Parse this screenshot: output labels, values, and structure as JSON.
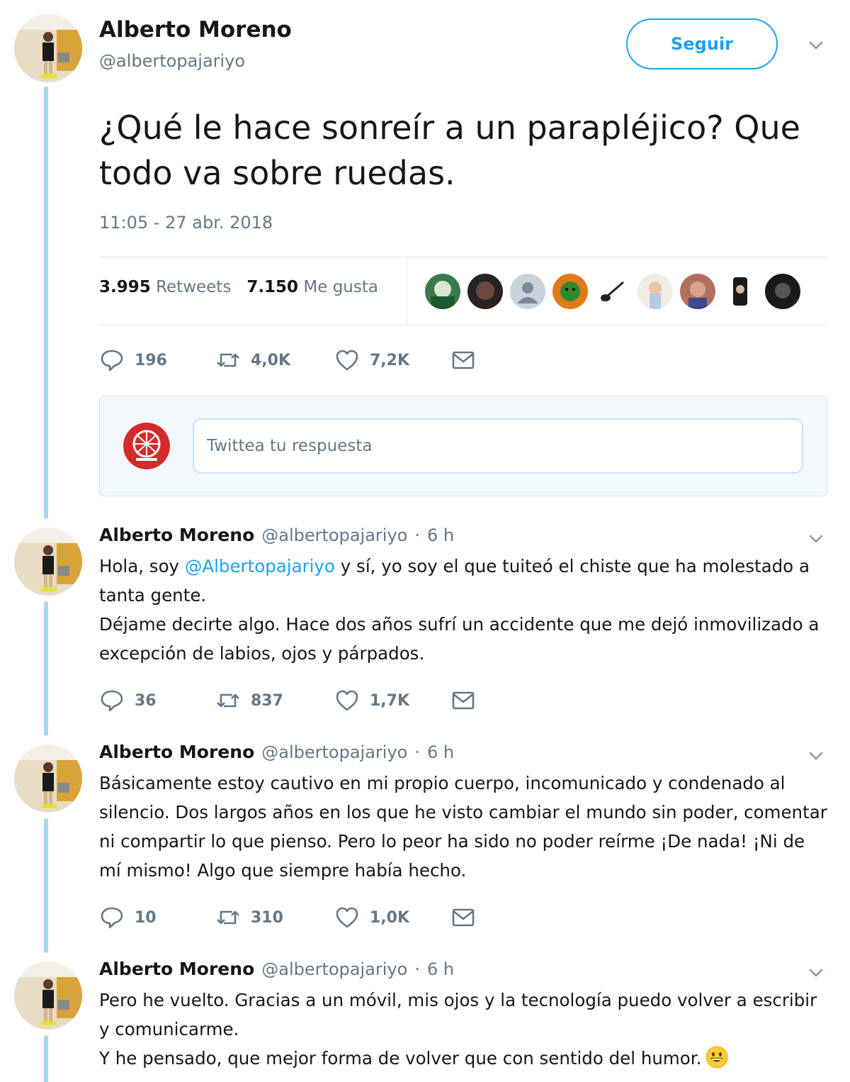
{
  "main_tweet": {
    "name": "Alberto Moreno",
    "handle": "@albertopajariyo",
    "follow_label": "Seguir",
    "text": "¿Qué le hace sonreír a un parapléjico? Que todo va sobre ruedas.",
    "timestamp": "11:05 - 27 abr. 2018",
    "retweets_count": "3.995",
    "retweets_label": "Retweets",
    "likes_count": "7.150",
    "likes_label": "Me gusta",
    "actions": {
      "replies": "196",
      "retweets": "4,0K",
      "likes": "7,2K"
    }
  },
  "reply_box": {
    "placeholder": "Twittea tu respuesta"
  },
  "thread": [
    {
      "name": "Alberto Moreno",
      "handle": "@albertopajariyo",
      "sep": "·",
      "time": "6 h",
      "text_before": "Hola, soy ",
      "mention": "@Albertopajariyo",
      "text_after": " y sí, yo soy el que tuiteó el chiste que ha molestado a tanta gente.\nDéjame decirte algo. Hace dos años sufrí un accidente que me dejó inmovilizado a excepción de labios, ojos y párpados.",
      "actions": {
        "replies": "36",
        "retweets": "837",
        "likes": "1,7K"
      }
    },
    {
      "name": "Alberto Moreno",
      "handle": "@albertopajariyo",
      "sep": "·",
      "time": "6 h",
      "text": "Básicamente estoy cautivo en mi propio cuerpo, incomunicado y condenado al silencio. Dos largos años en los que he visto cambiar el mundo sin poder, comentar ni compartir lo que pienso. Pero lo peor ha sido no poder reírme ¡De nada! ¡Ni de mí mismo! Algo que siempre había hecho.",
      "actions": {
        "replies": "10",
        "retweets": "310",
        "likes": "1,0K"
      }
    },
    {
      "name": "Alberto Moreno",
      "handle": "@albertopajariyo",
      "sep": "·",
      "time": "6 h",
      "text": "Pero he vuelto. Gracias a un móvil, mis ojos y la tecnología puedo volver a escribir y comunicarme.\nY he pensado, que mejor forma de volver que con sentido del humor.",
      "emoji": "grinning-face"
    }
  ],
  "icons": {
    "reply": "speech-bubble-icon",
    "retweet": "retweet-icon",
    "like": "heart-icon",
    "dm": "envelope-icon",
    "menu": "chevron-down-icon"
  },
  "colors": {
    "accent": "#1da1f2",
    "muted": "#657786",
    "thread_line": "#a8d8f0",
    "text": "#14171a"
  }
}
